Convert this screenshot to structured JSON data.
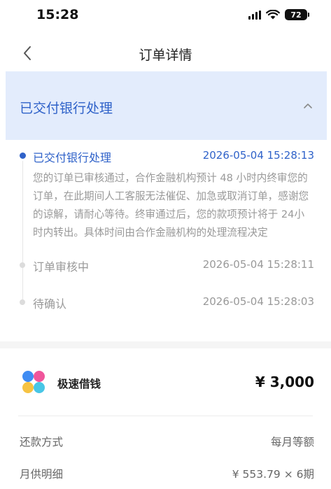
{
  "status_bar": {
    "time": "15:28",
    "battery": "72"
  },
  "nav": {
    "title": "订单详情",
    "back_icon": "chevron-left-icon"
  },
  "status_card": {
    "title": "已交付银行处理",
    "collapse_icon": "chevron-up-icon",
    "bg_color": "#e3ecfc",
    "accent_color": "#2f62c9"
  },
  "timeline": [
    {
      "label": "已交付银行处理",
      "time": "2026-05-04 15:28:13",
      "description": "您的订单已审核通过，合作金融机构预计 48 小时内终审您的订单，在此期间人工客服无法催促、加急或取消订单，感谢您的谅解，请耐心等待。终审通过后，您的款项预计将于 24小时内转出。具体时间由合作金融机构的处理流程决定"
    },
    {
      "label": "订单审核中",
      "time": "2026-05-04 15:28:11"
    },
    {
      "label": "待确认",
      "time": "2026-05-04 15:28:03"
    }
  ],
  "product": {
    "name": "极速借钱",
    "amount": "¥ 3,000",
    "logo_icon": "four-petal-logo-icon"
  },
  "details": [
    {
      "label": "还款方式",
      "value": "每月等额"
    },
    {
      "label": "月供明细",
      "value": "¥ 553.79 × 6期"
    }
  ]
}
